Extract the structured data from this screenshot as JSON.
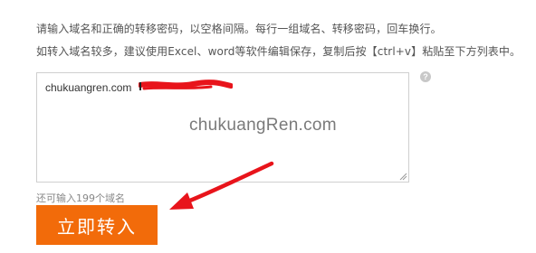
{
  "instructions": {
    "line1": "请输入域名和正确的转移密码，以空格间隔。每行一组域名、转移密码，回车换行。",
    "line2": "如转入域名较多，建议使用Excel、word等软件编辑保存，复制后按【ctrl+v】粘贴至下方列表中。"
  },
  "domain_input": {
    "value": "chukuangren.com"
  },
  "help_icon": {
    "glyph": "?",
    "icon": "question-circle-icon"
  },
  "watermark": {
    "text": "chukuangRen.com"
  },
  "remaining_hint": "还可输入199个域名",
  "submit_button": {
    "label": "立即转入",
    "color": "#f26b0a"
  },
  "annotations": {
    "arrow_color": "#e8141b",
    "redaction_color": "#e8141b"
  }
}
